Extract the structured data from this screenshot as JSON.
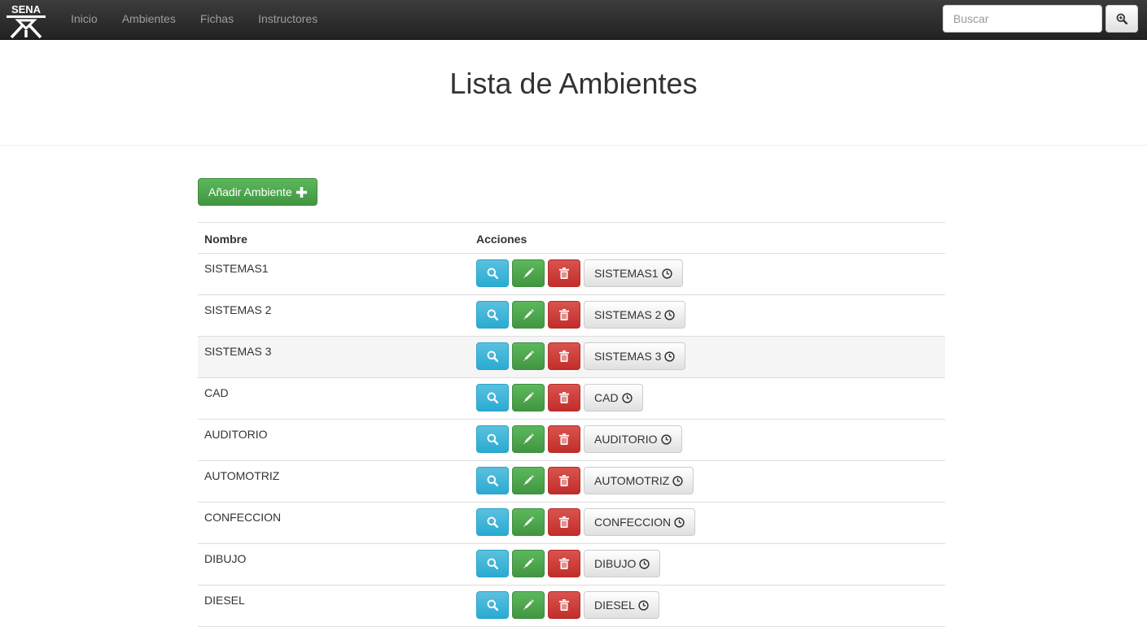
{
  "navbar": {
    "brand": "SENA",
    "links": [
      {
        "label": "Inicio",
        "name": "nav-inicio"
      },
      {
        "label": "Ambientes",
        "name": "nav-ambientes"
      },
      {
        "label": "Fichas",
        "name": "nav-fichas"
      },
      {
        "label": "Instructores",
        "name": "nav-instructores"
      }
    ],
    "search_placeholder": "Buscar",
    "search_icon": "zoom-in-icon"
  },
  "page": {
    "title": "Lista de Ambientes",
    "add_button_label": "Añadir Ambiente",
    "add_button_icon": "plus-icon"
  },
  "table": {
    "headers": {
      "name": "Nombre",
      "actions": "Acciones"
    },
    "rows": [
      {
        "name": "SISTEMAS1",
        "schedule_label": "SISTEMAS1"
      },
      {
        "name": "SISTEMAS 2",
        "schedule_label": "SISTEMAS 2"
      },
      {
        "name": "SISTEMAS 3",
        "schedule_label": "SISTEMAS 3"
      },
      {
        "name": "CAD",
        "schedule_label": "CAD"
      },
      {
        "name": "AUDITORIO",
        "schedule_label": "AUDITORIO"
      },
      {
        "name": "AUTOMOTRIZ",
        "schedule_label": "AUTOMOTRIZ"
      },
      {
        "name": "CONFECCION",
        "schedule_label": "CONFECCION"
      },
      {
        "name": "DIBUJO",
        "schedule_label": "DIBUJO"
      },
      {
        "name": "DIESEL",
        "schedule_label": "DIESEL"
      }
    ],
    "row_icons": {
      "view": "search-icon",
      "edit": "pencil-icon",
      "delete": "trash-icon",
      "schedule": "clock-icon"
    },
    "highlighted_row": 2
  },
  "colors": {
    "navbar": "#222222",
    "info": "#5bc0de",
    "success": "#5cb85c",
    "danger": "#d9534f",
    "row_hover": "#f5f5f5"
  }
}
